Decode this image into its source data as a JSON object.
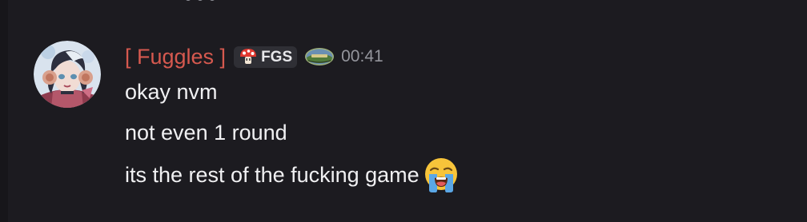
{
  "message": {
    "author": {
      "name": "[ Fuggles ]",
      "avatar_icon": "avatar-image",
      "name_color": "#d6594f"
    },
    "clan_tag": {
      "icon": "mushroom-icon",
      "text": "FGS"
    },
    "badge_icon": "landscape-badge-icon",
    "timestamp": "00:41",
    "lines": [
      {
        "text": "okay nvm"
      },
      {
        "text": "not even 1 round"
      },
      {
        "text": "its the rest of the fucking game",
        "emoji": "loudly-crying-face-emoji"
      }
    ]
  },
  "colors": {
    "background": "#1c1b20",
    "text": "#f0f0f2",
    "muted": "#94959c",
    "tag_background": "#2f2f35"
  }
}
